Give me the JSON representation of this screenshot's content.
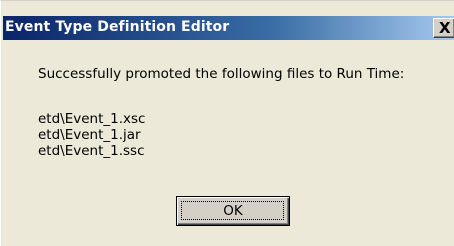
{
  "window": {
    "title": "Event Type Definition Editor",
    "close_label": "X"
  },
  "message": "Successfully promoted the following files to Run Time:",
  "files": [
    "etd\\Event_1.xsc",
    "etd\\Event_1.jar",
    "etd\\Event_1.ssc"
  ],
  "buttons": {
    "ok_label": "OK"
  }
}
